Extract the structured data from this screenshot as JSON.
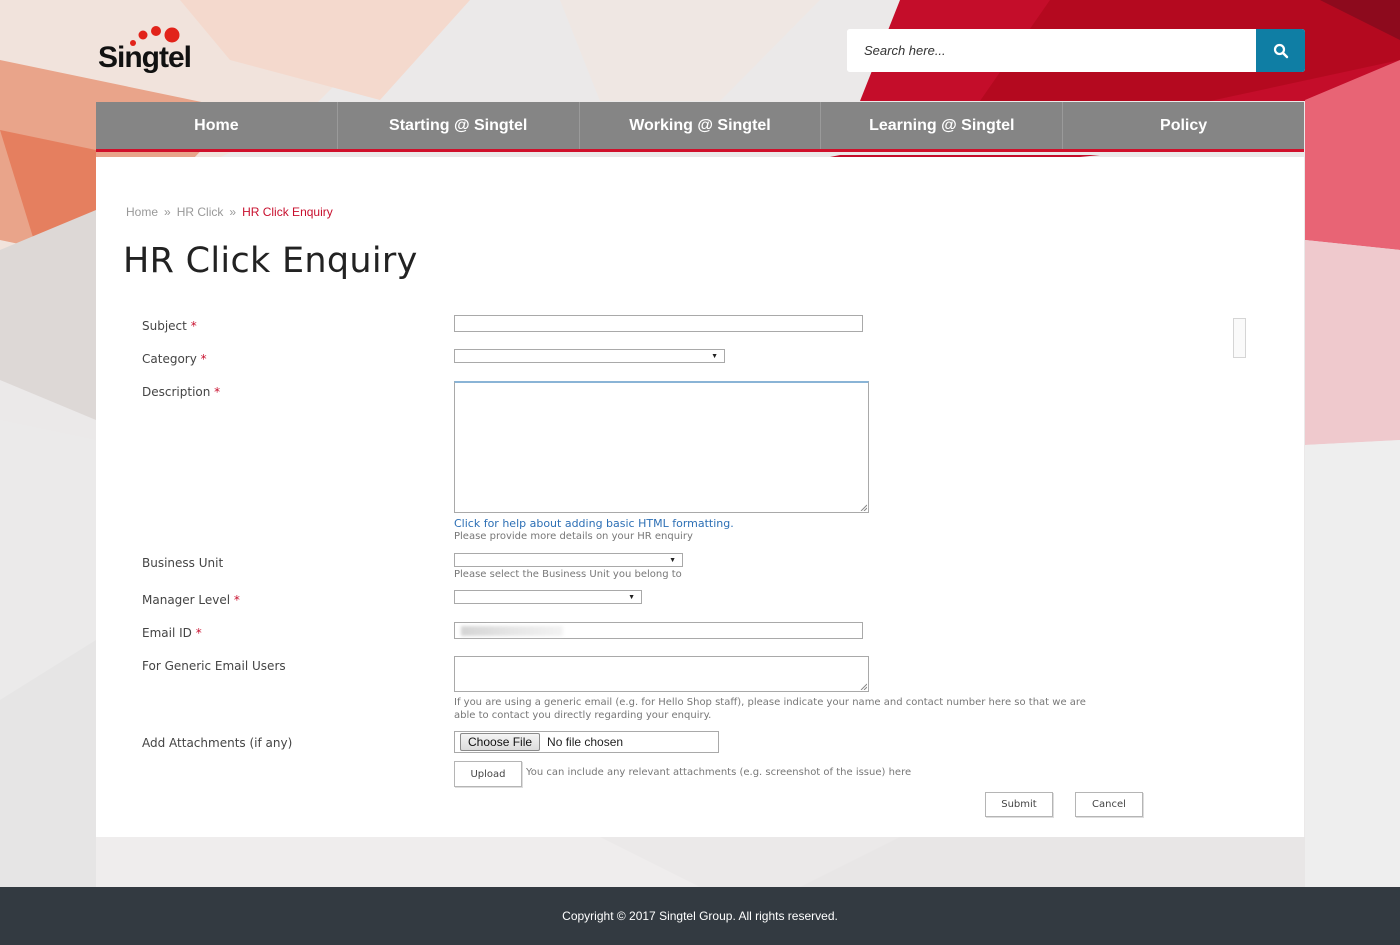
{
  "brand": {
    "name": "Singtel"
  },
  "search": {
    "placeholder": "Search here...",
    "icon": "search-icon"
  },
  "nav": {
    "items": [
      {
        "label": "Home"
      },
      {
        "label": "Starting @ Singtel"
      },
      {
        "label": "Working @ Singtel"
      },
      {
        "label": "Learning @ Singtel"
      },
      {
        "label": "Policy"
      }
    ]
  },
  "breadcrumb": {
    "items": [
      "Home",
      "HR Click"
    ],
    "current": "HR Click Enquiry",
    "separator": "»"
  },
  "page": {
    "title": "HR Click Enquiry"
  },
  "form": {
    "required_marker": "*",
    "subject_label": "Subject",
    "category_label": "Category",
    "description_label": "Description",
    "description_help_link": "Click for help about adding basic HTML formatting.",
    "description_hint": "Please provide more details on your HR enquiry",
    "business_unit_label": "Business Unit",
    "business_unit_hint": "Please select the Business Unit you belong to",
    "manager_level_label": "Manager Level",
    "email_label": "Email ID",
    "generic_email_label": "For Generic Email Users",
    "generic_email_hint_1": "If you are using a generic email (e.g. for Hello Shop staff),  please indicate your name and contact number here so that we are",
    "generic_email_hint_2": "able to contact you directly regarding your enquiry.",
    "attachments_label": "Add Attachments (if any)",
    "choose_file_label": "Choose File",
    "file_status": "No file chosen",
    "upload_label": "Upload",
    "upload_hint": "You can include any relevant attachments (e.g. screenshot of the issue) here",
    "submit_label": "Submit",
    "cancel_label": "Cancel",
    "dropdown_arrow": "▼"
  },
  "footer": {
    "copyright": "Copyright © 2017 Singtel Group. All rights reserved."
  },
  "colors": {
    "accent_red": "#c8102e",
    "nav_gray": "#858585",
    "search_button": "#0f7ea4",
    "footer_bg": "#333a41",
    "link_blue": "#2c6fb5"
  }
}
